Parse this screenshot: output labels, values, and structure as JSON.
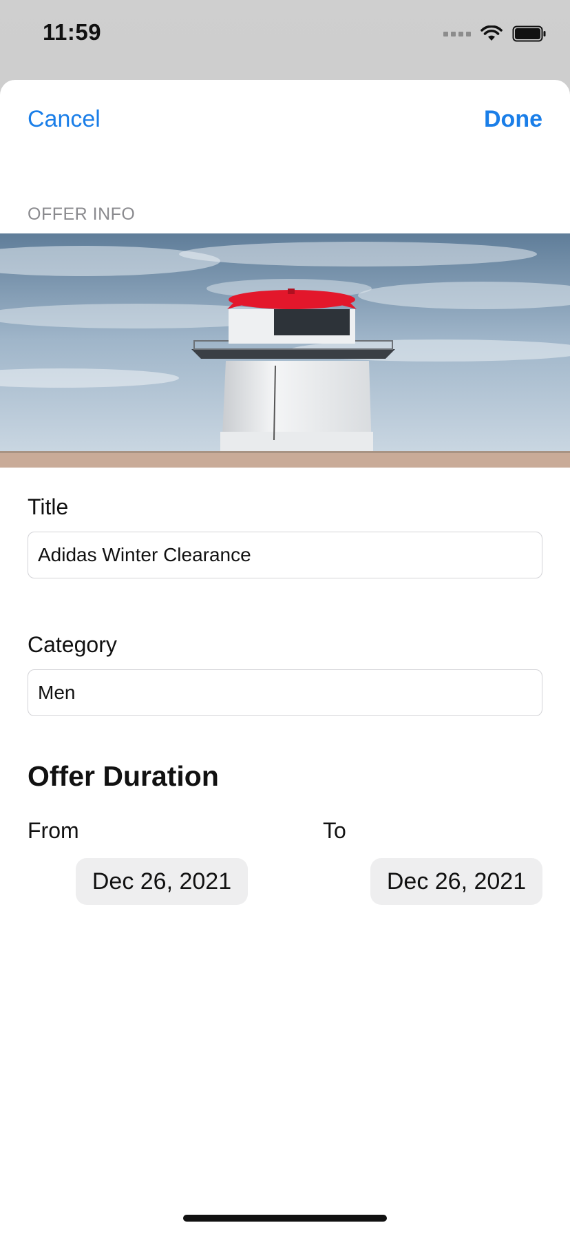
{
  "status_bar": {
    "time": "11:59"
  },
  "nav": {
    "cancel_label": "Cancel",
    "done_label": "Done"
  },
  "form": {
    "section_header": "OFFER INFO",
    "title_label": "Title",
    "title_value": "Adidas Winter Clearance",
    "category_label": "Category",
    "category_value": "Men"
  },
  "duration": {
    "heading": "Offer Duration",
    "from_label": "From",
    "from_value": "Dec 26, 2021",
    "to_label": "To",
    "to_value": "Dec 26, 2021"
  },
  "colors": {
    "accent": "#1a7ee8",
    "lighthouse_roof": "#e3172b",
    "sky": "#8fa9c0",
    "sand": "#c9ab98"
  },
  "icons": [
    "signal-icon",
    "wifi-icon",
    "battery-icon"
  ]
}
